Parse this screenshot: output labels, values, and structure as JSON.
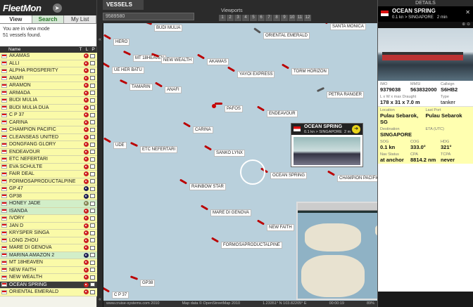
{
  "app": {
    "title": "FleetMon",
    "tabs": [
      "View",
      "Search",
      "My List"
    ],
    "view_mode": "You are in view mode",
    "vessels_found": "51 vessels found."
  },
  "list_columns": [
    "Name",
    "T",
    "L",
    "P"
  ],
  "vessels": [
    {
      "name": "AKAMAS",
      "hl": false,
      "icon": "red"
    },
    {
      "name": "ALLI",
      "hl": false,
      "icon": "red"
    },
    {
      "name": "ALPHA PROSPERITY",
      "hl": false,
      "icon": "red"
    },
    {
      "name": "ANAFI",
      "hl": false,
      "icon": "red"
    },
    {
      "name": "ARAMON",
      "hl": false,
      "icon": "red"
    },
    {
      "name": "ARMADA",
      "hl": false,
      "icon": "red"
    },
    {
      "name": "BUDI MULIA",
      "hl": false,
      "icon": "red"
    },
    {
      "name": "BUDI MULIA DUA",
      "hl": false,
      "icon": "red"
    },
    {
      "name": "C P 37",
      "hl": false,
      "icon": "red"
    },
    {
      "name": "CARINA",
      "hl": false,
      "icon": "red"
    },
    {
      "name": "CHAMPION PACIFIC",
      "hl": false,
      "icon": "red"
    },
    {
      "name": "CLEANSEAS UNITED",
      "hl": false,
      "icon": "red"
    },
    {
      "name": "DONGFANG GLORY",
      "hl": false,
      "icon": "red"
    },
    {
      "name": "ENDEAVOUR",
      "hl": false,
      "icon": "red"
    },
    {
      "name": "ETC NEFERTARI",
      "hl": false,
      "icon": "red"
    },
    {
      "name": "EVA SCHULTE",
      "hl": false,
      "icon": "red"
    },
    {
      "name": "FAIR DEAL",
      "hl": false,
      "icon": "red"
    },
    {
      "name": "FORMOSAPRODUCTALPINE",
      "hl": false,
      "icon": "red"
    },
    {
      "name": "GP 47",
      "hl": false,
      "icon": "blue"
    },
    {
      "name": "GP38",
      "hl": false,
      "icon": "blue"
    },
    {
      "name": "HONEY JADE",
      "hl": true,
      "icon": "olive"
    },
    {
      "name": "ISANDA",
      "hl": true,
      "icon": "red"
    },
    {
      "name": "IVORY",
      "hl": false,
      "icon": "red"
    },
    {
      "name": "JAN D",
      "hl": false,
      "icon": "red"
    },
    {
      "name": "KRYSPER SINGA",
      "hl": false,
      "icon": "red"
    },
    {
      "name": "LONG ZHOU",
      "hl": false,
      "icon": "red"
    },
    {
      "name": "MARE DI GENOVA",
      "hl": false,
      "icon": "red"
    },
    {
      "name": "MARINA AMAZON 2",
      "hl": true,
      "icon": "blue"
    },
    {
      "name": "MT 18HEAVEN",
      "hl": false,
      "icon": "red"
    },
    {
      "name": "NEW FAITH",
      "hl": false,
      "icon": "red"
    },
    {
      "name": "NEW WEALTH",
      "hl": false,
      "icon": "red"
    },
    {
      "name": "OCEAN SPRING",
      "hl": false,
      "icon": "red",
      "selected": true
    },
    {
      "name": "ORIENTAL EMERALD",
      "hl": false,
      "icon": "red"
    }
  ],
  "top": {
    "vessels_tab": "VESSELS",
    "search_value": "9589580",
    "viewports_label": "Viewports",
    "viewports": [
      "1",
      "2",
      "3",
      "4",
      "5",
      "6",
      "7",
      "8",
      "9",
      "10",
      "11",
      "12"
    ]
  },
  "map_labels": [
    {
      "text": "BUDI MULIA",
      "gray": false
    },
    {
      "text": "ORIENTAL EMERALD",
      "gray": true
    },
    {
      "text": "MT 18HEAVEN",
      "gray": false
    },
    {
      "text": "NEW WEALTH",
      "gray": false
    },
    {
      "text": "AKAMAS",
      "gray": false
    },
    {
      "text": "UE HER BATU",
      "gray": false
    },
    {
      "text": "YAYOI EXPRESS",
      "gray": false
    },
    {
      "text": "TORM HORIZON",
      "gray": false
    },
    {
      "text": "TAMARIN",
      "gray": false
    },
    {
      "text": "ANAFI",
      "gray": false
    },
    {
      "text": "PETRA RANGER",
      "gray": true
    },
    {
      "text": "PAFOS",
      "gray": false
    },
    {
      "text": "ENDEAVOUR",
      "gray": false
    },
    {
      "text": "CARINA",
      "gray": false
    },
    {
      "text": "ETC NEFERTARI",
      "gray": false
    },
    {
      "text": "SANKO LYNX",
      "gray": false
    },
    {
      "text": "OCEAN SPRING",
      "gray": false
    },
    {
      "text": "CHAMPION PACIFIC",
      "gray": false
    },
    {
      "text": "RAINBOW STAR",
      "gray": false
    },
    {
      "text": "MARE DI GENOVA",
      "gray": false
    },
    {
      "text": "NEW FAITH",
      "gray": false
    },
    {
      "text": "FORMOSAPRODUCTALPINE",
      "gray": false
    },
    {
      "text": "GP38",
      "gray": false
    },
    {
      "text": "C P 37",
      "gray": false
    },
    {
      "text": "SANTA MONICA",
      "gray": false
    },
    {
      "text": "HERO",
      "gray": false
    },
    {
      "text": "UDE",
      "gray": false
    }
  ],
  "popup": {
    "name": "OCEAN SPRING",
    "sub": "0.1 kn > SINGAPORE",
    "time": "2 m"
  },
  "status": {
    "left": "www.cruise-systems.com 2010",
    "middle": "Map data © OpenStreetMap 2010",
    "coords": "1.23351° N    103.82205° E",
    "time": "00:00:19",
    "zoom": "89%"
  },
  "details": {
    "title": "DETAILS",
    "name": "OCEAN SPRING",
    "sub": "0.1 kn > SINGAPORE",
    "age": "2 min",
    "fields": {
      "imo_label": "IMO",
      "imo": "9379038",
      "mmsi_label": "MMSI",
      "mmsi": "563832000",
      "callsign_label": "Callsign",
      "callsign": "S6HB2",
      "dim_label": "L x W x max Draught",
      "dim": "178 x 31 x 7.0 m",
      "type_label": "Type",
      "type": "tanker",
      "location_label": "Location",
      "location": "Pulau Sebarok, SG",
      "lastport_label": "Last Port",
      "lastport": "Pulau Sebarok",
      "dest_label": "Destination",
      "dest": "SINGAPORE",
      "eta_label": "ETA (UTC)",
      "eta": "",
      "sog_label": "SOG",
      "sog": "0.1 kn",
      "cog_label": "COG",
      "cog": "333.0°",
      "hdg_label": "HDG",
      "hdg": "321°",
      "navstat_label": "Nav Status",
      "navstat": "at anchor",
      "cpa_label": "CPA",
      "cpa": "8814.2 nm",
      "tcpa_label": "TCPA",
      "tcpa": "never"
    }
  },
  "colors": {
    "accent": "#e8d31a",
    "ship": "#b00000",
    "sea": "#b9d0dc",
    "list_yellow": "#fafaa8",
    "list_green": "#d2eec8"
  }
}
